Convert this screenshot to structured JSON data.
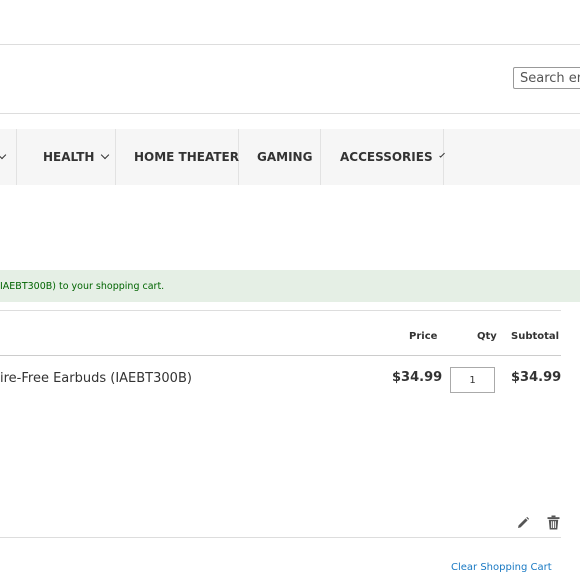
{
  "search": {
    "placeholder": "Search entire store here..."
  },
  "nav": {
    "items": [
      {
        "label": "",
        "has_dropdown": true
      },
      {
        "label": "HEALTH",
        "has_dropdown": true
      },
      {
        "label": "HOME THEATER",
        "has_dropdown": false
      },
      {
        "label": "GAMING",
        "has_dropdown": false
      },
      {
        "label": "ACCESSORIES",
        "has_dropdown": true
      }
    ]
  },
  "message": {
    "text": "IAEBT300B) to your shopping cart."
  },
  "cart": {
    "headers": {
      "price": "Price",
      "qty": "Qty",
      "subtotal": "Subtotal"
    },
    "items": [
      {
        "name": "ire-Free Earbuds (IAEBT300B)",
        "price": "$34.99",
        "qty": "1",
        "subtotal": "$34.99"
      }
    ],
    "clear_label": "Clear Shopping Cart"
  },
  "colors": {
    "message_bg": "#e5efe5",
    "message_text": "#006400",
    "link": "#1979c3",
    "nav_bg": "#f6f6f6"
  },
  "icons": {
    "edit": "pencil-icon",
    "delete": "trash-icon",
    "dropdown": "chevron-down-icon"
  }
}
